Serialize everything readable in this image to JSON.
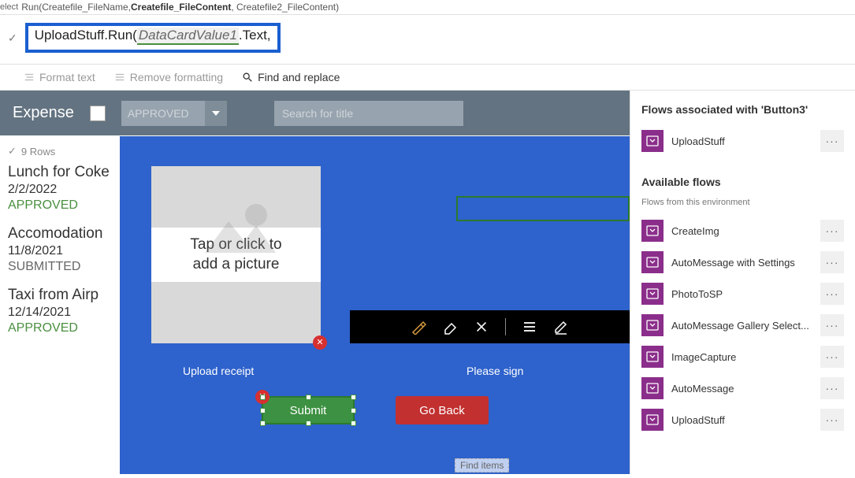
{
  "hint": {
    "left": "elect",
    "prefix": "Run(Createfile_FileName, ",
    "bold": "Createfile_FileContent",
    "suffix": ", Createfile2_FileContent)"
  },
  "formula": {
    "p1": "UploadStuff.Run(",
    "underlined": "DataCardValue1",
    "p2": ".Text,"
  },
  "toolbar": {
    "format": "Format text",
    "remove": "Remove formatting",
    "find": "Find and replace"
  },
  "expense": {
    "title": "Expense",
    "dropdown": "APPROVED",
    "searchPlaceholder": "Search for title",
    "rows": "9 Rows"
  },
  "cards": [
    {
      "title": "Lunch for Coke",
      "date": "2/2/2022",
      "status": "APPROVED",
      "statusClass": "status-approved"
    },
    {
      "title": "Accomodation",
      "date": "11/8/2021",
      "status": "SUBMITTED",
      "statusClass": "status-submitted"
    },
    {
      "title": "Taxi from Airp",
      "date": "12/14/2021",
      "status": "APPROVED",
      "statusClass": "status-approved"
    }
  ],
  "upload": {
    "prompt1": "Tap or click to",
    "prompt2": "add a picture",
    "label": "Upload receipt"
  },
  "sign": {
    "label": "Please sign"
  },
  "buttons": {
    "submit": "Submit",
    "goback": "Go Back"
  },
  "findItems": "Find items",
  "panel": {
    "associated": "Flows associated with 'Button3'",
    "associatedFlows": [
      "UploadStuff"
    ],
    "availableHeading": "Available flows",
    "envSub": "Flows from this environment",
    "availableFlows": [
      "CreateImg",
      "AutoMessage with Settings",
      "PhotoToSP",
      "AutoMessage Gallery Select...",
      "ImageCapture",
      "AutoMessage",
      "UploadStuff"
    ]
  }
}
